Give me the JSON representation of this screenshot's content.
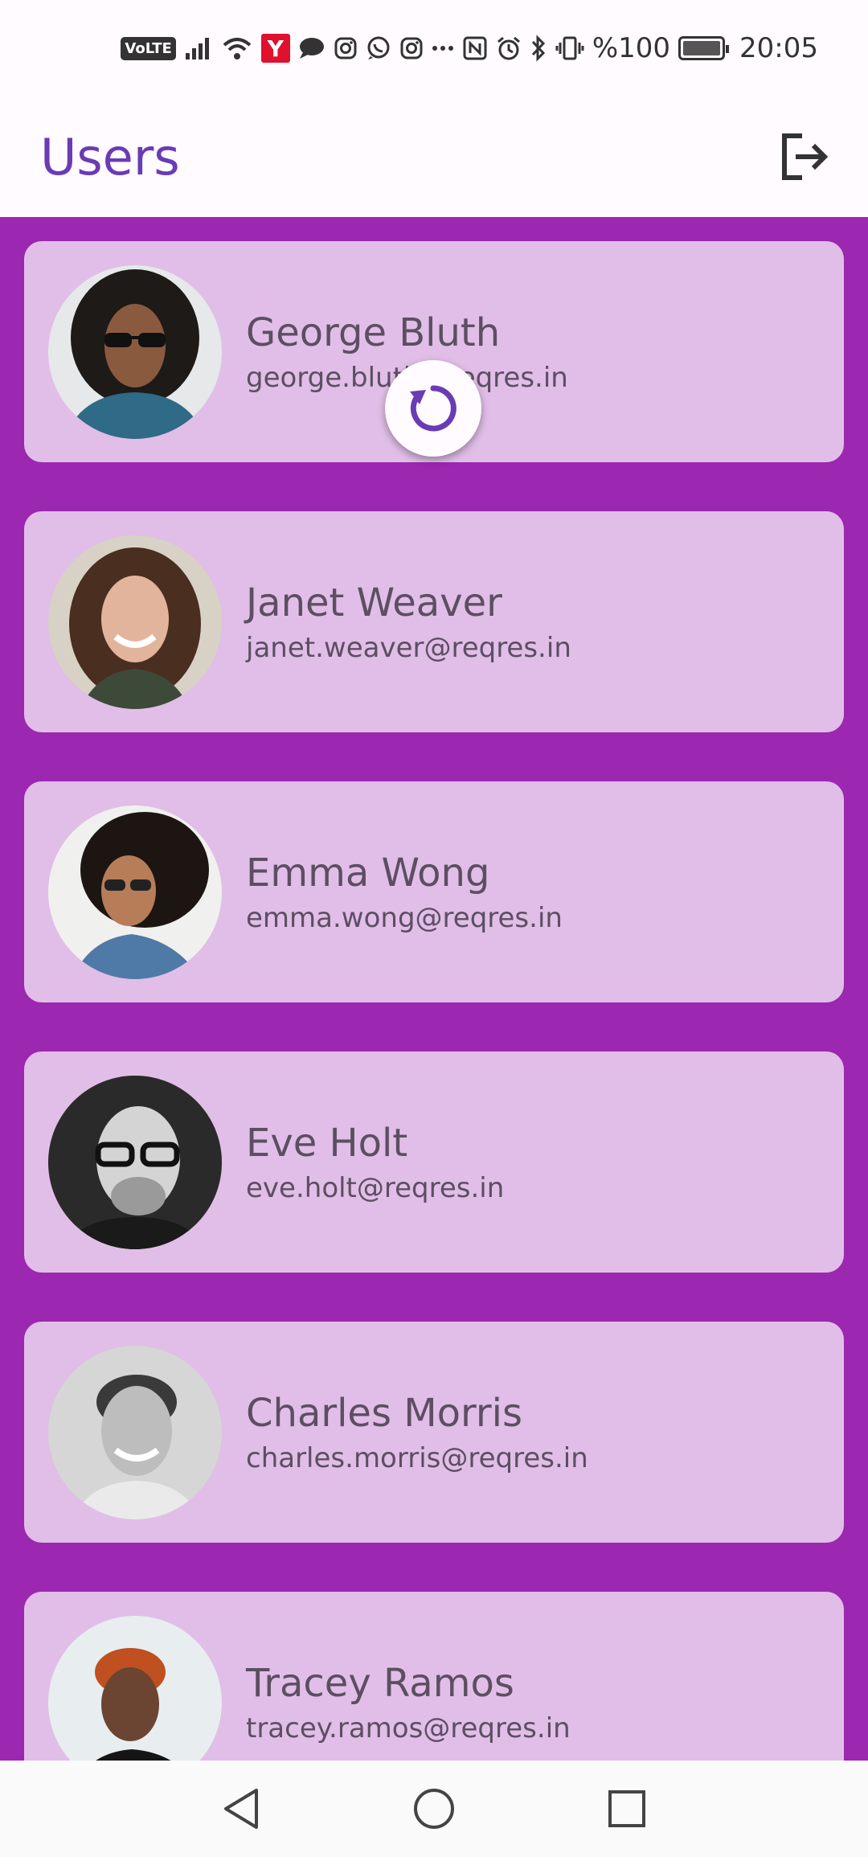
{
  "status_bar": {
    "volte": "VoLTE",
    "carrier_badge": "Y",
    "battery_percent": "%100",
    "time": "20:05",
    "icons": [
      "signal-icon",
      "wifi-icon",
      "yandex-icon",
      "message-icon",
      "instagram-icon",
      "whatsapp-icon",
      "instagram-icon",
      "more-icon",
      "nfc-icon",
      "alarm-icon",
      "bluetooth-icon",
      "vibrate-icon",
      "battery-icon"
    ]
  },
  "app_bar": {
    "title": "Users",
    "logout_icon": "logout-icon"
  },
  "users": [
    {
      "name": "George Bluth",
      "email": "george.bluth@reqres.in"
    },
    {
      "name": "Janet Weaver",
      "email": "janet.weaver@reqres.in"
    },
    {
      "name": "Emma Wong",
      "email": "emma.wong@reqres.in"
    },
    {
      "name": "Eve Holt",
      "email": "eve.holt@reqres.in"
    },
    {
      "name": "Charles Morris",
      "email": "charles.morris@reqres.in"
    },
    {
      "name": "Tracey Ramos",
      "email": "tracey.ramos@reqres.in"
    }
  ],
  "refresh_indicator": "refresh-icon",
  "nav_bar": {
    "buttons": [
      "back-icon",
      "home-icon",
      "recents-icon"
    ]
  },
  "colors": {
    "background": "#9c27b0",
    "card": "#e1bee7",
    "title": "#6a3bb5",
    "text": "#5d4e63",
    "appbar": "#fffbfe"
  }
}
